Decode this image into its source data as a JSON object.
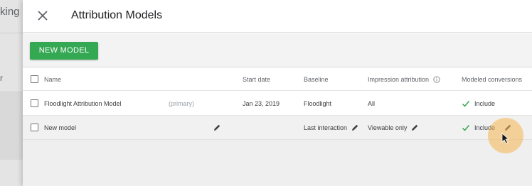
{
  "background": {
    "tab_fragment": "king",
    "side_letter": "r"
  },
  "dialog": {
    "title": "Attribution Models",
    "close_icon": "close-icon",
    "new_button_label": "NEW MODEL",
    "columns": {
      "name": "Name",
      "start_date": "Start date",
      "baseline": "Baseline",
      "impression_attribution": "Impression attribution",
      "modeled_conversions": "Modeled conversions"
    },
    "rows": [
      {
        "name": "Floodlight Attribution Model",
        "tag": "(primary)",
        "start_date": "Jan 23, 2019",
        "baseline": "Floodlight",
        "impression_attribution": "All",
        "modeled_conversions": "Include"
      },
      {
        "name": "New model",
        "tag": "",
        "start_date": "",
        "baseline": "Last interaction",
        "impression_attribution": "Viewable only",
        "modeled_conversions": "Include"
      }
    ]
  },
  "colors": {
    "accent_green": "#34a853",
    "check_green": "#34a853",
    "cursor_highlight": "#f5b450"
  }
}
